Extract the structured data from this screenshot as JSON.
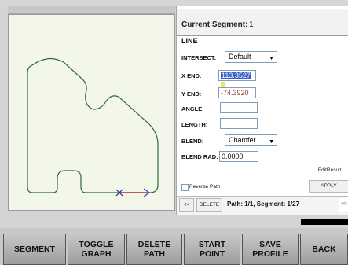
{
  "panel": {
    "current_segment_label": "Current Segment:",
    "current_segment_value": "1",
    "segment_type": "LINE",
    "intersect_label": "INTERSECT:",
    "intersect_value": "Default",
    "x_end_label": "X END:",
    "x_end_value": "113.3527",
    "y_end_label": "Y END:",
    "y_end_value": "-74.3920",
    "angle_label": "ANGLE:",
    "angle_value": "",
    "length_label": "LENGTH:",
    "length_value": "",
    "blend_label": "BLEND:",
    "blend_value": "Chamfer",
    "blend_rad_label": "BLEND RAD:",
    "blend_rad_value": "0.0000",
    "edit_result": "EditResult",
    "reverse_path_label": "Reverse Path",
    "apply_label": "APPLY",
    "prev_label": "<<",
    "delete_label": "DELETE",
    "path_status": "Path: 1/1, Segment: 1/27",
    "next_label": ">>"
  },
  "bottom_buttons": {
    "segment": "SEGMENT",
    "toggle_1": "TOGGLE",
    "toggle_2": "GRAPH",
    "delete_1": "DELETE",
    "delete_2": "PATH",
    "start_1": "START",
    "start_2": "POINT",
    "save_1": "SAVE",
    "save_2": "PROFILE",
    "back": "BACK"
  },
  "colors": {
    "path": "#2e6b35",
    "highlight": "#3a5fcd",
    "direction_arrow": "#c03030",
    "start_marker": "#1a2ea0"
  }
}
